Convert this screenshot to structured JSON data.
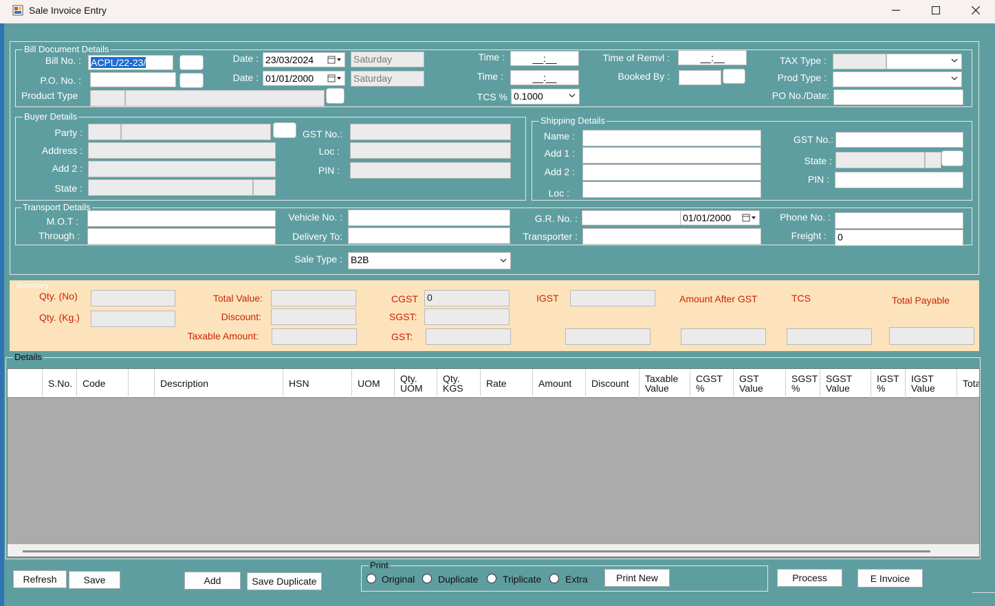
{
  "window": {
    "title": "Sale Invoice Entry"
  },
  "bill": {
    "group_label": "Bill Document Details",
    "bill_no_label": "Bill No. :",
    "bill_no_value": "ACPL/22-23/",
    "po_no_label": "P.O. No. :",
    "po_no_value": "",
    "product_type_label": "Product Type",
    "date1_label": "Date :",
    "date1_value": "23/03/2024",
    "day1": "Saturday",
    "date2_label": "Date :",
    "date2_value": "01/01/2000",
    "day2": "Saturday",
    "time1_label": "Time :",
    "time1_value": "__:__",
    "time2_label": "Time :",
    "time2_value": "__:__",
    "tcs_label": "TCS %",
    "tcs_value": "0.1000",
    "remvl_label": "Time of Remvl :",
    "remvl_value": "__:__",
    "booked_by_label": "Booked By :",
    "tax_type_label": "TAX Type :",
    "prod_type_label": "Prod Type :",
    "po_date_label": "PO No./Date:"
  },
  "buyer": {
    "group_label": "Buyer Details",
    "party_label": "Party :",
    "address_label": "Address :",
    "add2_label": "Add 2 :",
    "state_label": "State :",
    "gst_label": "GST No.:",
    "loc_label": "Loc :",
    "pin_label": "PIN :"
  },
  "shipping": {
    "group_label": "Shipping Details",
    "name_label": "Name :",
    "add1_label": "Add 1 :",
    "add2_label": "Add 2 :",
    "loc_label": "Loc :",
    "gst_label": "GST No.:",
    "state_label": "State :",
    "pin_label": "PIN :"
  },
  "transport": {
    "group_label": "Transport Details",
    "mot_label": "M.O.T :",
    "through_label": "Through :",
    "vehicle_label": "Vehicle No. :",
    "delivery_label": "Delivery To:",
    "gr_label": "G.R. No. :",
    "gr_date": "01/01/2000",
    "transporter_label": "Transporter :",
    "phone_label": "Phone No. :",
    "freight_label": "Freight :",
    "freight_value": "0"
  },
  "sale_type": {
    "label": "Sale Type :",
    "value": "B2B"
  },
  "summary": {
    "group_label": "Summary",
    "qty_no_label": "Qty. (No)",
    "qty_kg_label": "Qty. (Kg.)",
    "total_value_label": "Total Value:",
    "discount_label": "Discount:",
    "taxable_label": "Taxable Amount:",
    "cgst_label": "CGST",
    "cgst_value": "0",
    "sgst_label": "SGST:",
    "gst_label": "GST:",
    "igst_label": "IGST",
    "after_gst_label": "Amount After GST",
    "tcs_label": "TCS",
    "total_payable_label": "Total Payable"
  },
  "details": {
    "group_label": "Details",
    "columns": [
      "S.No.",
      "Code",
      "",
      "Description",
      "HSN",
      "UOM",
      "Qty.\nUOM",
      "Qty.\nKGS",
      "Rate",
      "Amount",
      "Discount",
      "Taxable\nValue",
      "CGST\n%",
      "GST\nValue",
      "SGST\n%",
      "SGST\nValue",
      "IGST\n%",
      "IGST\nValue",
      "Tota"
    ]
  },
  "actions": {
    "refresh": "Refresh",
    "save": "Save",
    "add": "Add",
    "save_duplicate": "Save Duplicate",
    "print_label": "Print",
    "original": "Original",
    "duplicate": "Duplicate",
    "triplicate": "Triplicate",
    "extra": "Extra",
    "print_new": "Print New",
    "process": "Process",
    "e_invoice": "E Invoice"
  },
  "colors": {
    "background": "#5f9ea0",
    "summary_bg": "#fce3bc",
    "label_red": "#cc2200",
    "selection": "#1d6fd0"
  }
}
